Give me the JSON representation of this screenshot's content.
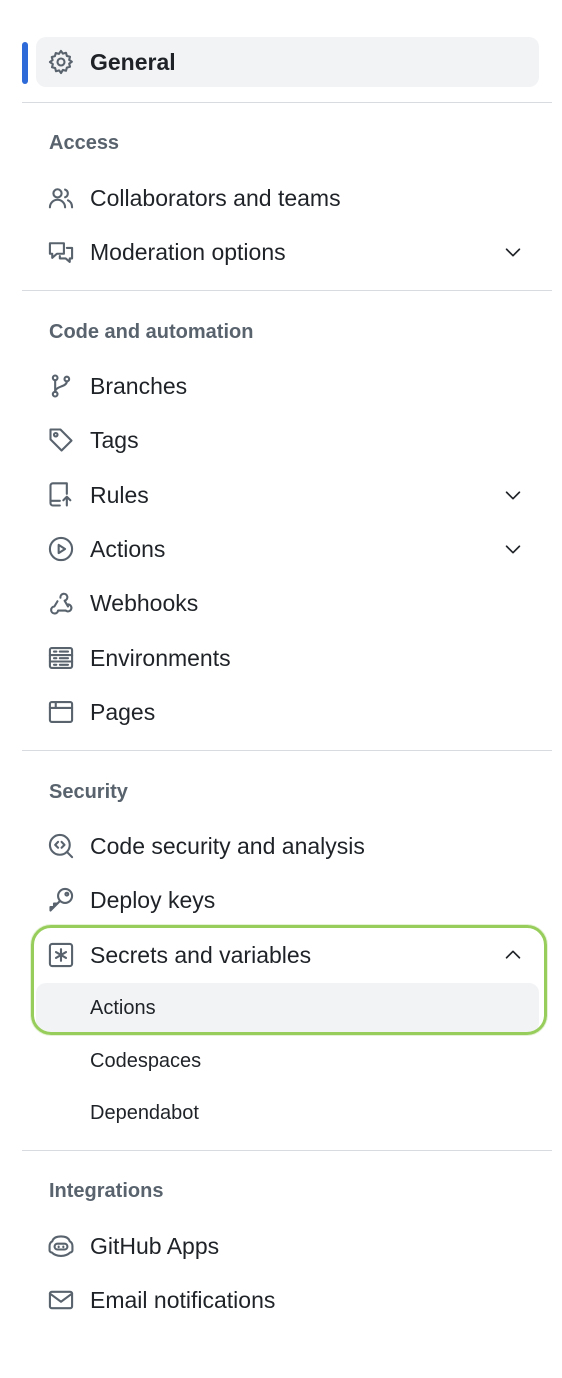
{
  "general": {
    "label": "General",
    "icon": "gear-icon"
  },
  "sections": {
    "access": {
      "heading": "Access",
      "items": [
        {
          "label": "Collaborators and teams",
          "icon": "people-icon"
        },
        {
          "label": "Moderation options",
          "icon": "comment-discussion-icon",
          "expandable": true
        }
      ]
    },
    "code": {
      "heading": "Code and automation",
      "items": [
        {
          "label": "Branches",
          "icon": "git-branch-icon"
        },
        {
          "label": "Tags",
          "icon": "tag-icon"
        },
        {
          "label": "Rules",
          "icon": "repo-push-icon",
          "expandable": true
        },
        {
          "label": "Actions",
          "icon": "play-icon",
          "expandable": true
        },
        {
          "label": "Webhooks",
          "icon": "webhook-icon"
        },
        {
          "label": "Environments",
          "icon": "server-icon"
        },
        {
          "label": "Pages",
          "icon": "browser-icon"
        }
      ]
    },
    "security": {
      "heading": "Security",
      "items": [
        {
          "label": "Code security and analysis",
          "icon": "codescan-icon"
        },
        {
          "label": "Deploy keys",
          "icon": "key-icon"
        },
        {
          "label": "Secrets and variables",
          "icon": "asterisk-icon",
          "expanded": true
        }
      ],
      "subitems": [
        {
          "label": "Actions",
          "selected": true
        },
        {
          "label": "Codespaces"
        },
        {
          "label": "Dependabot"
        }
      ]
    },
    "integrations": {
      "heading": "Integrations",
      "items": [
        {
          "label": "GitHub Apps",
          "icon": "copilot-icon"
        },
        {
          "label": "Email notifications",
          "icon": "mail-icon"
        }
      ]
    }
  },
  "colors": {
    "active_indicator": "#2f6bd8",
    "highlight_ring": "#97cd5b",
    "selected_background": "#f2f3f5"
  }
}
